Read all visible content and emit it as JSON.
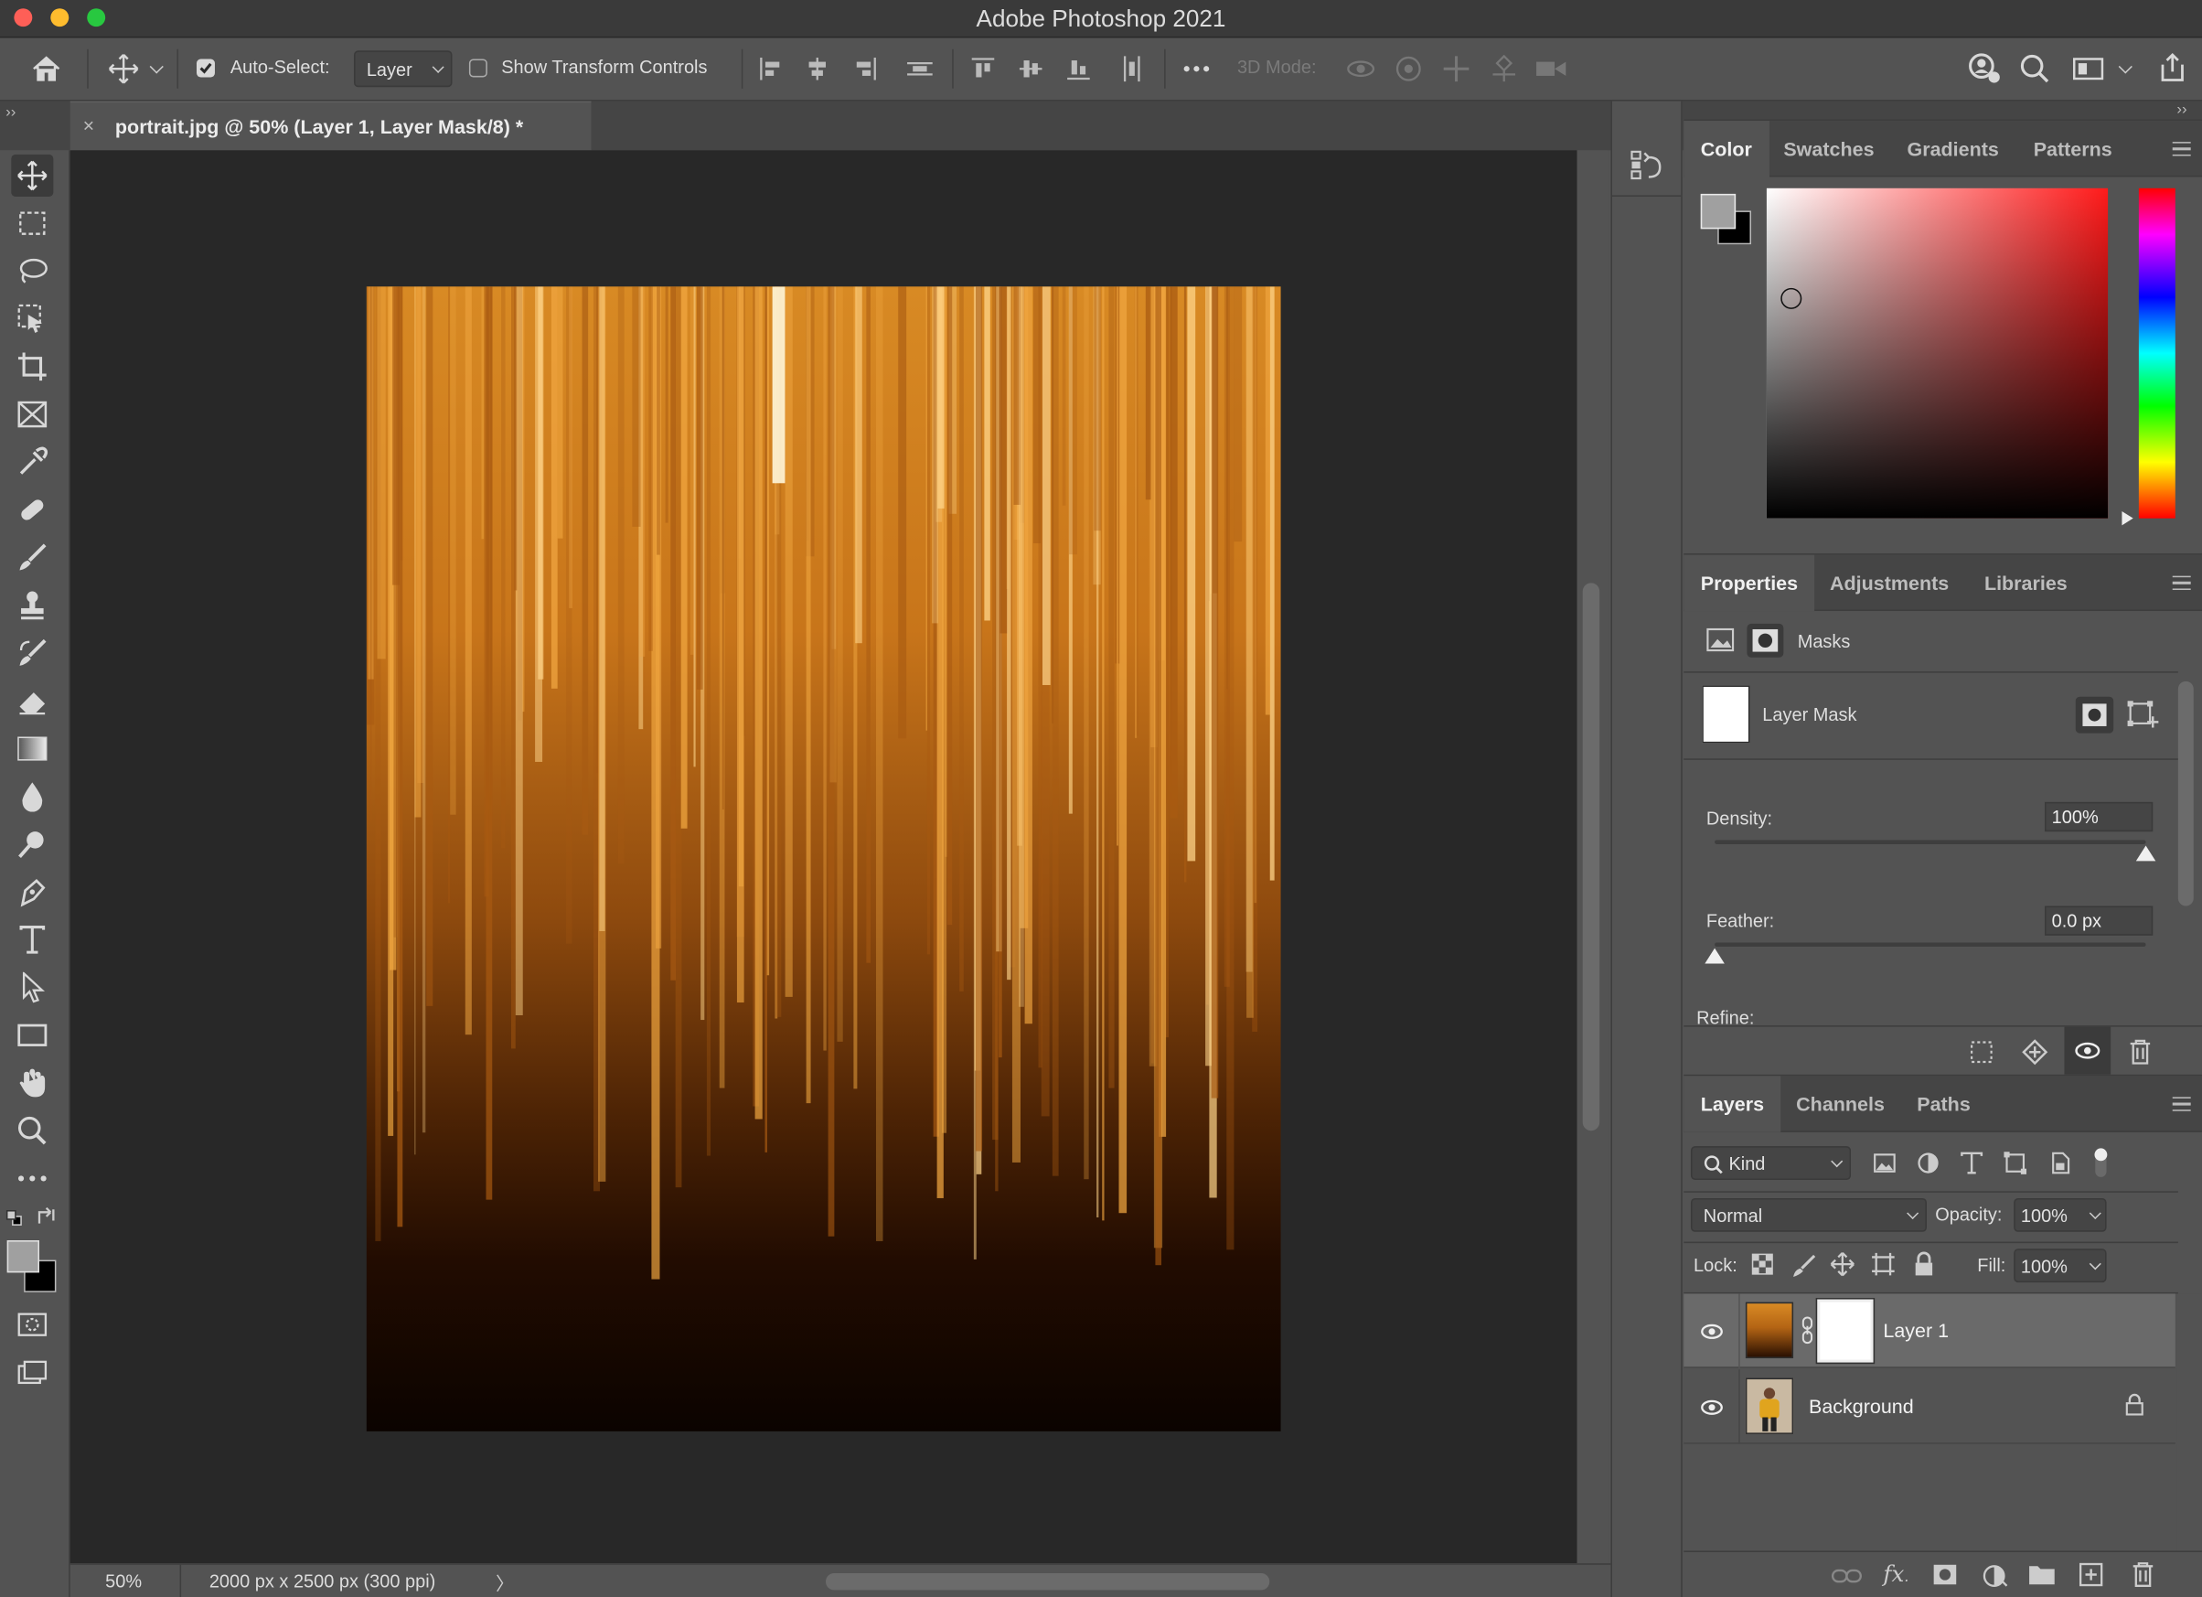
{
  "app": {
    "title": "Adobe Photoshop 2021"
  },
  "options_bar": {
    "auto_select_label": "Auto-Select:",
    "auto_select_target": "Layer",
    "transform_controls_label": "Show Transform Controls",
    "mode_3d_label": "3D Mode:",
    "auto_select_checked": true,
    "transform_controls_checked": false
  },
  "document": {
    "tab_title": "portrait.jpg @ 50% (Layer 1, Layer Mask/8) *",
    "zoom": "50%",
    "info": "2000 px x 2500 px (300 ppi)"
  },
  "color_panel": {
    "tabs": [
      "Color",
      "Swatches",
      "Gradients",
      "Patterns"
    ],
    "active_tab": "Color",
    "foreground": "#a0a0a0",
    "background": "#000000"
  },
  "properties_panel": {
    "tabs": [
      "Properties",
      "Adjustments",
      "Libraries"
    ],
    "active_tab": "Properties",
    "section": "Masks",
    "mask_label": "Layer Mask",
    "density_label": "Density:",
    "density_value": "100%",
    "density_fraction": 1.0,
    "feather_label": "Feather:",
    "feather_value": "0.0 px",
    "feather_fraction": 0.0,
    "refine_label": "Refine:"
  },
  "layers_panel": {
    "tabs": [
      "Layers",
      "Channels",
      "Paths"
    ],
    "active_tab": "Layers",
    "filter_kind": "Kind",
    "blend_mode": "Normal",
    "opacity_label": "Opacity:",
    "opacity_value": "100%",
    "lock_label": "Lock:",
    "fill_label": "Fill:",
    "fill_value": "100%",
    "layers": [
      {
        "name": "Layer 1",
        "selected": true,
        "visible": true
      },
      {
        "name": "Background",
        "selected": false,
        "visible": true,
        "locked": true
      }
    ]
  },
  "tools": [
    "move-tool",
    "marquee-tool",
    "lasso-tool",
    "object-selection-tool",
    "crop-tool",
    "frame-tool",
    "eyedropper-tool",
    "healing-brush-tool",
    "brush-tool",
    "clone-stamp-tool",
    "history-brush-tool",
    "eraser-tool",
    "gradient-tool",
    "blur-tool",
    "dodge-tool",
    "pen-tool",
    "type-tool",
    "path-selection-tool",
    "rectangle-tool",
    "hand-tool",
    "zoom-tool",
    "edit-toolbar"
  ]
}
